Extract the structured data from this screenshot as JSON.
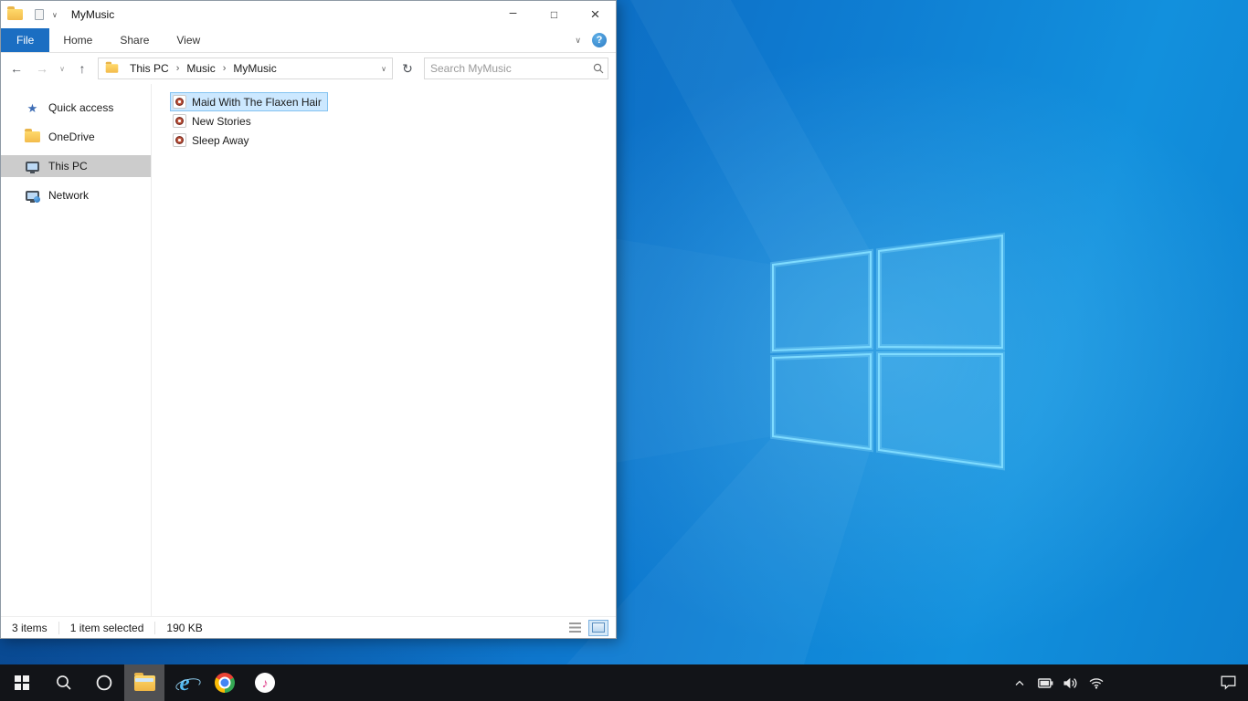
{
  "explorer": {
    "title": "MyMusic",
    "controls": {
      "minimize": "–",
      "maximize": "□",
      "close": "×"
    },
    "tabs": [
      {
        "label": "File",
        "active": true
      },
      {
        "label": "Home",
        "active": false
      },
      {
        "label": "Share",
        "active": false
      },
      {
        "label": "View",
        "active": false
      }
    ],
    "ribbon": {
      "collapse_glyph": "∨",
      "help_glyph": "?"
    },
    "nav": {
      "back_glyph": "←",
      "forward_glyph": "→",
      "history_glyph": "∨",
      "up_glyph": "↑",
      "refresh_glyph": "↻",
      "address_dropdown_glyph": "∨"
    },
    "breadcrumbs": {
      "separator": "›",
      "items": [
        {
          "label": "This PC"
        },
        {
          "label": "Music"
        },
        {
          "label": "MyMusic"
        }
      ]
    },
    "search": {
      "placeholder": "Search MyMusic"
    },
    "sidebar": {
      "items": [
        {
          "label": "Quick access",
          "icon": "star-icon",
          "selected": false
        },
        {
          "label": "OneDrive",
          "icon": "onedrive-folder-icon",
          "selected": false
        },
        {
          "label": "This PC",
          "icon": "computer-icon",
          "selected": true
        },
        {
          "label": "Network",
          "icon": "network-icon",
          "selected": false
        }
      ]
    },
    "files": [
      {
        "name": "Maid With The Flaxen Hair",
        "icon": "music-file-icon",
        "selected": true
      },
      {
        "name": "New Stories",
        "icon": "music-file-icon",
        "selected": false
      },
      {
        "name": "Sleep Away",
        "icon": "music-file-icon",
        "selected": false
      }
    ],
    "status": {
      "count": "3 items",
      "selected": "1 item selected",
      "size": "190 KB"
    },
    "view_buttons": [
      "details-view",
      "thumbnails-view"
    ]
  },
  "glyphs": {
    "star": "★",
    "note": "♪",
    "ie_letter": "e"
  },
  "taskbar": {
    "icons": [
      "start",
      "search",
      "cortana",
      "file-explorer",
      "internet-explorer",
      "chrome",
      "itunes"
    ],
    "active_icon": "file-explorer"
  },
  "tray": {
    "icons": [
      "hidden-icons-chevron",
      "battery",
      "volume",
      "network",
      "action-center"
    ]
  },
  "colors": {
    "file_tab_blue": "#1b6ec2",
    "selection_bg": "#cce8ff",
    "selection_border": "#84c3f1",
    "sidebar_selected": "#cccccc",
    "taskbar_bg": "#121418",
    "wallpaper_main": "#0e79cf"
  }
}
